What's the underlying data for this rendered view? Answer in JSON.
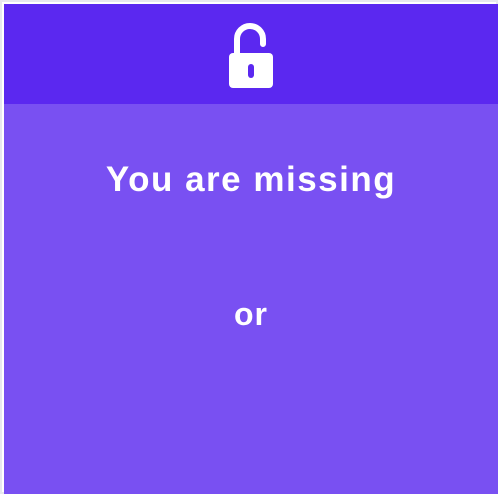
{
  "header": {
    "icon": "unlocked-padlock-icon",
    "background_color": "#5b28f0"
  },
  "main": {
    "headline": "You are missing",
    "divider_text": "or",
    "background_color": "#7950f2",
    "text_color": "#ffffff"
  }
}
